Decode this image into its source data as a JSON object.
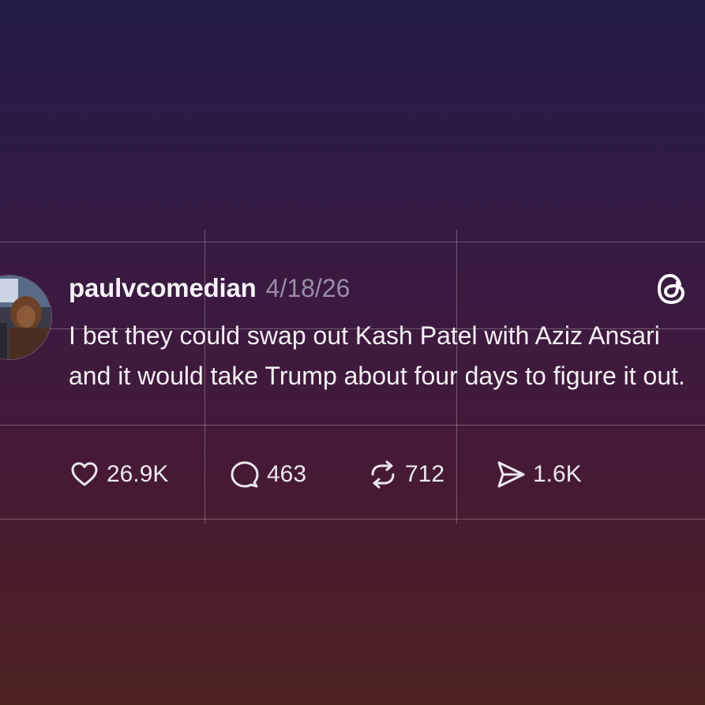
{
  "post": {
    "username": "paulvcomedian",
    "date": "4/18/26",
    "text": "I bet they could swap out Kash Patel with Aziz Ansari and it would take Trump about four days to figure it out."
  },
  "actions": {
    "likes": "26.9K",
    "replies": "463",
    "reposts": "712",
    "shares": "1.6K"
  },
  "icons": {
    "like": "heart-icon",
    "reply": "speech-bubble-icon",
    "repost": "repost-icon",
    "share": "send-icon",
    "app": "threads-logo-icon"
  },
  "colors": {
    "background_top": "#241c48",
    "background_bottom": "#4d2320",
    "text": "#f4f0f4",
    "date": "#9a8fa3"
  }
}
